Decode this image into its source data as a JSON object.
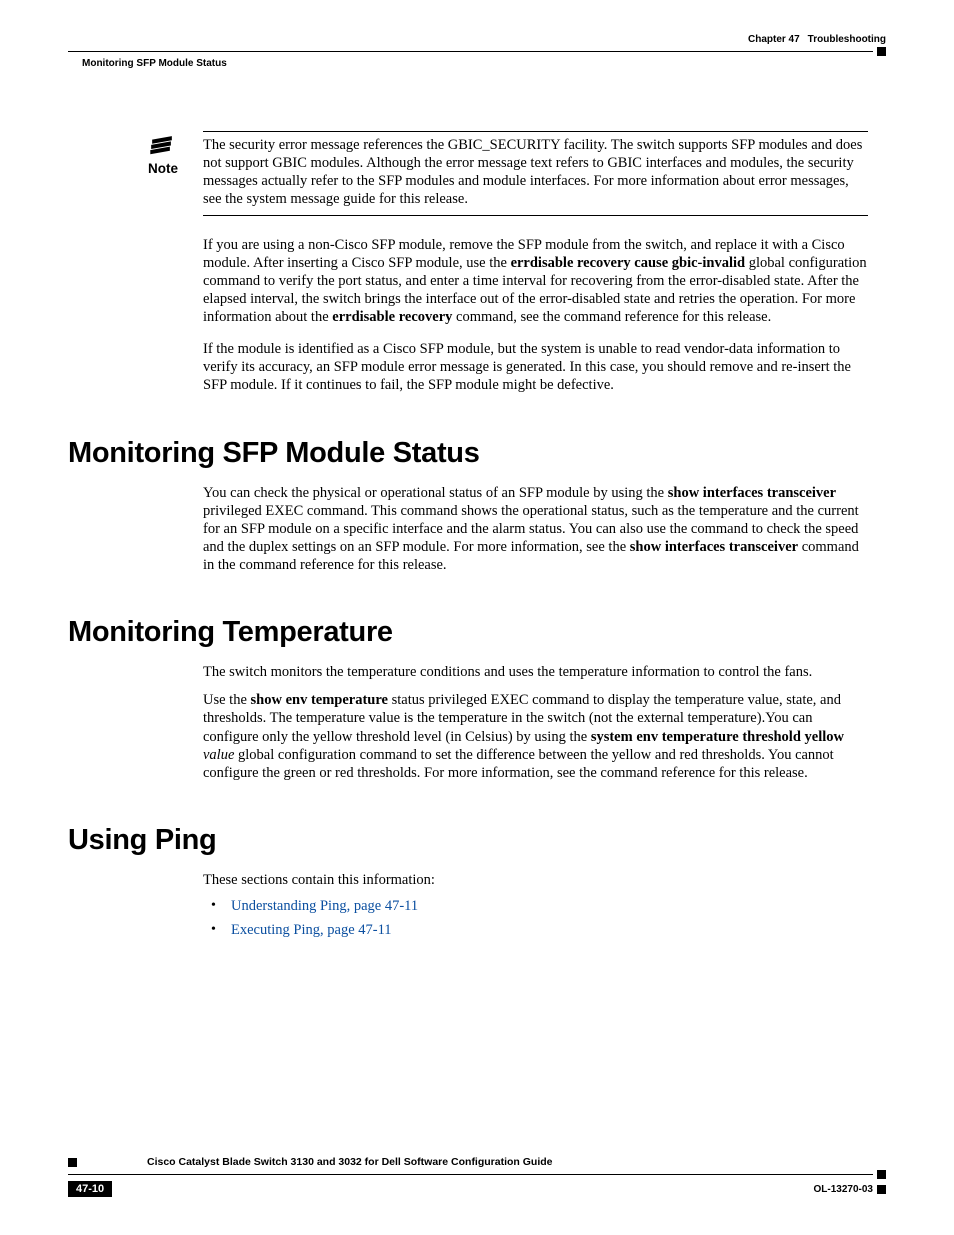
{
  "header": {
    "chapter_label": "Chapter 47",
    "chapter_title": "Troubleshooting",
    "running_head": "Monitoring SFP Module Status"
  },
  "note": {
    "label": "Note",
    "text": "The security error message references the GBIC_SECURITY facility. The switch supports SFP modules and does not support GBIC modules. Although the error message text refers to GBIC interfaces and modules, the security messages actually refer to the SFP modules and module interfaces. For more information about error messages, see the system message guide for this release."
  },
  "para1": {
    "pre": "If you are using a non-Cisco SFP module, remove the SFP module from the switch, and replace it with a Cisco module. After inserting a Cisco SFP module, use the ",
    "cmd1": "errdisable recovery cause gbic-invalid",
    "mid1": " global configuration command to verify the port status, and enter a time interval for recovering from the error-disabled state. After the elapsed interval, the switch brings the interface out of the error-disabled state and retries the operation. For more information about the ",
    "cmd2": "errdisable recovery",
    "post": " command, see the command reference for this release."
  },
  "para2": "If the module is identified as a Cisco SFP module, but the system is unable to read vendor-data information to verify its accuracy, an SFP module error message is generated. In this case, you should remove and re-insert the SFP module. If it continues to fail, the SFP module might be defective.",
  "sections": {
    "sfp": {
      "title": "Monitoring SFP Module Status",
      "p_pre": "You can check the physical or operational status of an SFP module by using the ",
      "cmd1": "show interfaces transceiver",
      "p_mid": " privileged EXEC command. This command shows the operational status, such as the temperature and the current for an SFP module on a specific interface and the alarm status. You can also use the command to check the speed and the duplex settings on an SFP module. For more information, see the ",
      "cmd2": "show interfaces transceiver",
      "p_post": " command in the command reference for this release."
    },
    "temp": {
      "title": "Monitoring Temperature",
      "p1": "The switch monitors the temperature conditions and uses the temperature information to control the fans.",
      "p2_pre": "Use the ",
      "cmd1": "show env temperature",
      "p2_mid1": " status privileged EXEC command to display the temperature value, state, and thresholds. The temperature value is the temperature in the switch (not the external temperature).You can configure only the yellow threshold level (in Celsius) by using the ",
      "cmd2": "system env temperature threshold yellow",
      "val": "value",
      "p2_post": " global configuration command to set the difference between the yellow and red thresholds. You cannot configure the green or red thresholds. For more information, see the command reference for this release."
    },
    "ping": {
      "title": "Using Ping",
      "intro": "These sections contain this information:",
      "links": [
        "Understanding Ping, page 47-11",
        "Executing Ping, page 47-11"
      ]
    }
  },
  "footer": {
    "guide_title": "Cisco Catalyst Blade Switch 3130 and 3032 for Dell Software Configuration Guide",
    "page_num": "47-10",
    "doc_id": "OL-13270-03"
  }
}
